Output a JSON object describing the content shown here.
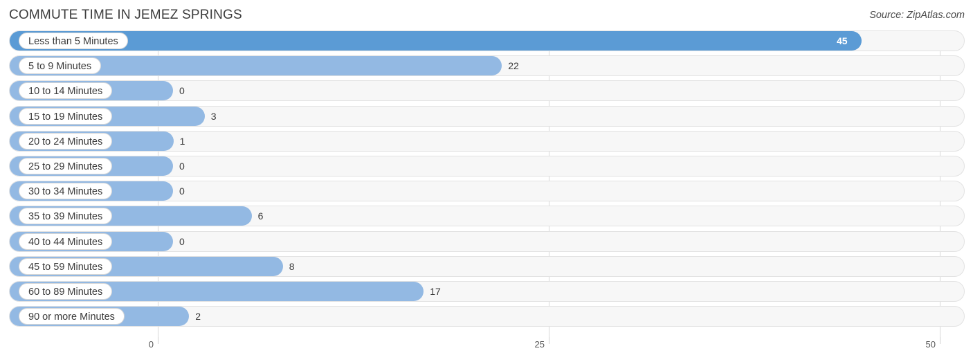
{
  "header": {
    "title": "COMMUTE TIME IN JEMEZ SPRINGS",
    "source": "Source: ZipAtlas.com"
  },
  "colors": {
    "bar_max": "#5b9bd5",
    "bar_normal": "#93b9e3",
    "track": "#f7f7f7",
    "grid": "#d8d8d8",
    "text": "#3a3a3a"
  },
  "chart_data": {
    "type": "bar",
    "orientation": "horizontal",
    "title": "COMMUTE TIME IN JEMEZ SPRINGS",
    "xlabel": "",
    "ylabel": "",
    "xlim": [
      0,
      50
    ],
    "xticks": [
      0,
      25,
      50
    ],
    "xtick_labels": [
      "0",
      "25",
      "50"
    ],
    "grid": true,
    "legend": null,
    "categories": [
      "Less than 5 Minutes",
      "5 to 9 Minutes",
      "10 to 14 Minutes",
      "15 to 19 Minutes",
      "20 to 24 Minutes",
      "25 to 29 Minutes",
      "30 to 34 Minutes",
      "35 to 39 Minutes",
      "40 to 44 Minutes",
      "45 to 59 Minutes",
      "60 to 89 Minutes",
      "90 or more Minutes"
    ],
    "values": [
      45,
      22,
      0,
      3,
      1,
      0,
      0,
      6,
      0,
      8,
      17,
      2
    ],
    "value_labels": [
      "45",
      "22",
      "0",
      "3",
      "1",
      "0",
      "0",
      "6",
      "0",
      "8",
      "17",
      "2"
    ]
  }
}
